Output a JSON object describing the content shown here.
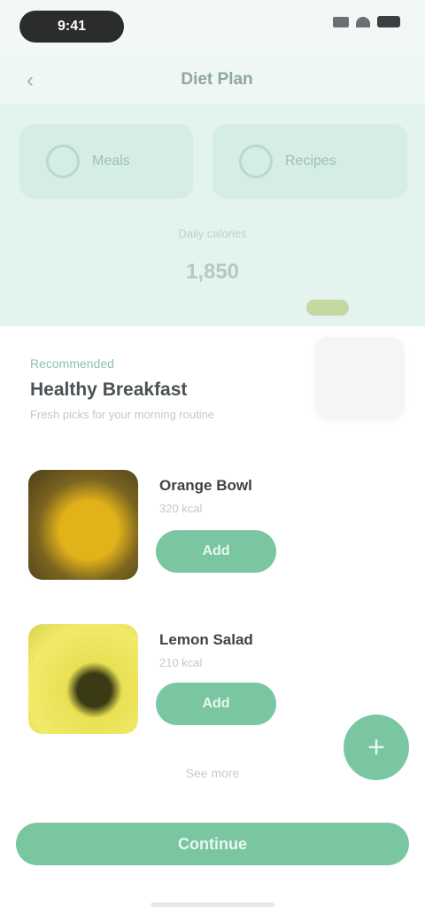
{
  "status_bar": {
    "time": "9:41"
  },
  "header": {
    "title": "Diet Plan",
    "back_icon": "chevron-left-icon"
  },
  "segments": [
    {
      "label": "Meals",
      "icon": "circle-icon"
    },
    {
      "label": "Recipes",
      "icon": "circle-icon"
    }
  ],
  "hero": {
    "caption": "Daily calories",
    "value": "1,850"
  },
  "card": {
    "overline": "Recommended",
    "title": "Healthy Breakfast",
    "subtitle": "Fresh picks for your morning routine"
  },
  "products": [
    {
      "name": "Orange Bowl",
      "meta": "320 kcal",
      "button": "Add"
    },
    {
      "name": "Lemon Salad",
      "meta": "210 kcal",
      "button": "Add"
    }
  ],
  "more_link": "See more",
  "primary_button": "Continue",
  "colors": {
    "accent": "#79c6a1",
    "hero_bg": "#e3f3ef"
  }
}
